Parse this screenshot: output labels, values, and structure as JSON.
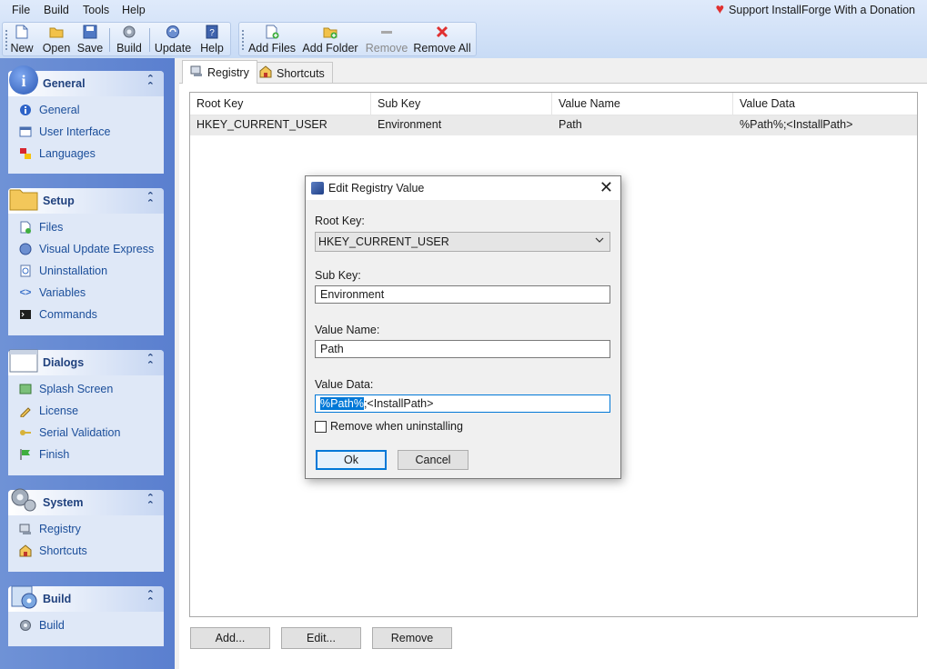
{
  "menu": [
    "File",
    "Build",
    "Tools",
    "Help"
  ],
  "donation": "Support InstallForge With a Donation",
  "toolbar": {
    "new": "New",
    "open": "Open",
    "save": "Save",
    "build": "Build",
    "update": "Update",
    "help": "Help",
    "add_files": "Add Files",
    "add_folder": "Add Folder",
    "remove": "Remove",
    "remove_all": "Remove All"
  },
  "sidebar": {
    "general": {
      "title": "General",
      "items": [
        "General",
        "User Interface",
        "Languages"
      ]
    },
    "setup": {
      "title": "Setup",
      "items": [
        "Files",
        "Visual Update Express",
        "Uninstallation",
        "Variables",
        "Commands"
      ]
    },
    "dialogs": {
      "title": "Dialogs",
      "items": [
        "Splash Screen",
        "License",
        "Serial Validation",
        "Finish"
      ]
    },
    "system": {
      "title": "System",
      "items": [
        "Registry",
        "Shortcuts"
      ]
    },
    "build": {
      "title": "Build",
      "items": [
        "Build"
      ]
    }
  },
  "tabs": [
    "Registry",
    "Shortcuts"
  ],
  "grid": {
    "columns": [
      "Root Key",
      "Sub Key",
      "Value Name",
      "Value Data"
    ],
    "rows": [
      [
        "HKEY_CURRENT_USER",
        "Environment",
        "Path",
        "%Path%;<InstallPath>"
      ]
    ]
  },
  "actions": {
    "add": "Add...",
    "edit": "Edit...",
    "remove": "Remove"
  },
  "dialog": {
    "title": "Edit Registry Value",
    "root_key_label": "Root Key:",
    "root_key_value": "HKEY_CURRENT_USER",
    "sub_key_label": "Sub Key:",
    "sub_key_value": "Environment",
    "value_name_label": "Value Name:",
    "value_name_value": "Path",
    "value_data_label": "Value Data:",
    "value_data_selected": "%Path%",
    "value_data_rest": ";<InstallPath>",
    "checkbox_label": "Remove when uninstalling",
    "ok": "Ok",
    "cancel": "Cancel"
  }
}
